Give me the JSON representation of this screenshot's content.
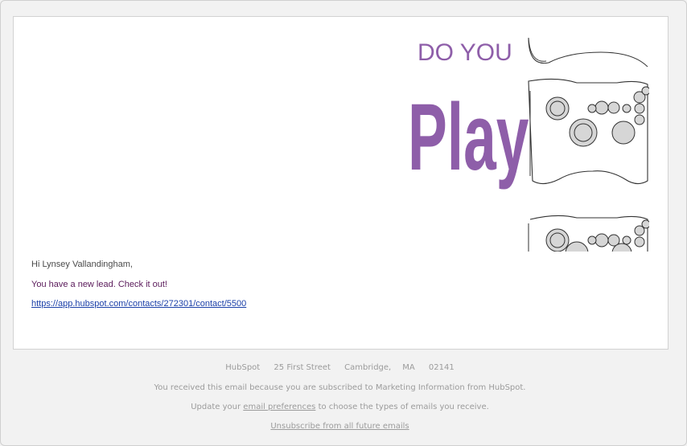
{
  "hero": {
    "line1": "DO YOU",
    "line2": "Play",
    "purple": "#8e5ea9",
    "icon": "game-controller-icon"
  },
  "email": {
    "greeting": "Hi Lynsey Vallandingham,",
    "lead_line": "You have a new lead. Check it out!",
    "contact_url": "https://app.hubspot.com/contacts/272301/contact/5500"
  },
  "footer": {
    "company": "HubSpot",
    "street": "25 First Street",
    "city": "Cambridge,",
    "state": "MA",
    "zip": "02141",
    "subscription_note": "You received this email because you are subscribed to Marketing Information from HubSpot.",
    "update_prefix": "Update your",
    "preferences_link": "email preferences",
    "update_suffix": "to choose the types of emails you receive.",
    "unsubscribe_link": "Unsubscribe from all future emails"
  },
  "colors": {
    "background": "#f2f2f2",
    "card": "#ffffff",
    "lead_text": "#5a1a5a",
    "link": "#1a3fa8",
    "footer_text": "#9b9b9b"
  }
}
